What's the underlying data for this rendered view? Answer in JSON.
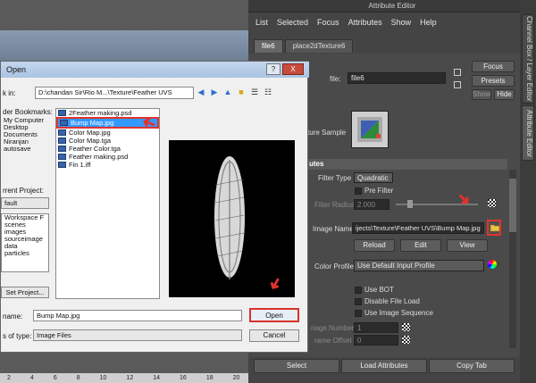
{
  "attribute_editor": {
    "title": "Attribute Editor",
    "menu": [
      "List",
      "Selected",
      "Focus",
      "Attributes",
      "Show",
      "Help"
    ],
    "tabs": [
      "file6",
      "place2dTexture6"
    ],
    "file_label": "file:",
    "file_value": "file6",
    "focus_btn": "Focus",
    "presets_btn": "Presets",
    "show_btn": "Show",
    "hide_btn": "Hide",
    "texture_sample_label": "ture Sample",
    "section_attributes": "utes",
    "filter_type_label": "Filter Type",
    "filter_type_value": "Quadratic",
    "pre_filter_label": "Pre Filter",
    "filter_radius_label": "Filter Radius",
    "filter_radius_value": "2.000",
    "image_name_label": "Image Name",
    "image_name_value": "ijects\\Texture\\Feather UVS\\Bump Map.jpg",
    "reload_btn": "Reload",
    "edit_btn": "Edit",
    "view_btn": "View",
    "color_profile_label": "Color Profile",
    "color_profile_value": "Use Default Input Profile",
    "use_bot_label": "Use BOT",
    "disable_file_load_label": "Disable File Load",
    "use_image_sequence_label": "Use Image Sequence",
    "image_number_label": "nage Number",
    "image_number_value": "1",
    "frame_offset_label": "rame Offset",
    "frame_offset_value": "0",
    "bottom_buttons": [
      "Select",
      "Load Attributes",
      "Copy Tab"
    ],
    "side_tabs": [
      "Channel Box / Layer Editor",
      "Attribute Editor"
    ]
  },
  "timeline": [
    "2",
    "4",
    "6",
    "8",
    "10",
    "12",
    "14",
    "16",
    "18",
    "20",
    "22",
    "24"
  ],
  "dialog": {
    "title": "Open",
    "help_btn": "?",
    "close_btn": "X",
    "look_in_label": "k in:",
    "path": "D:\\chandan Sir\\Rio M...\\Texture\\Feather UVS",
    "bookmarks_label": "der Bookmarks:",
    "bookmarks": [
      "My Computer",
      "Desktop",
      "Documents",
      "Niranjan",
      "autosave"
    ],
    "current_project_label": "rrent Project:",
    "current_project_value": "fault",
    "project_folders": [
      "Workspace F",
      "scenes",
      "images",
      "sourceimage",
      "data",
      "particles"
    ],
    "set_project_btn": "Set Project...",
    "files": [
      "2Feather making.psd",
      "Bump Map.jpg",
      "Color Map.jpg",
      "Color Map.tga",
      "Feather Color.tga",
      "Feather making.psd",
      "Fin 1.iff"
    ],
    "selected_file": "Bump Map.jpg",
    "name_label": "name:",
    "name_value": "Bump Map.jpg",
    "type_label": "s of type:",
    "type_value": "Image Files",
    "open_btn": "Open",
    "cancel_btn": "Cancel"
  },
  "colors": {
    "maya_panel": "#444444",
    "dialog_bg": "#f0f0f0",
    "selection_blue": "#3399ff",
    "annotation_red": "#e0332e"
  }
}
